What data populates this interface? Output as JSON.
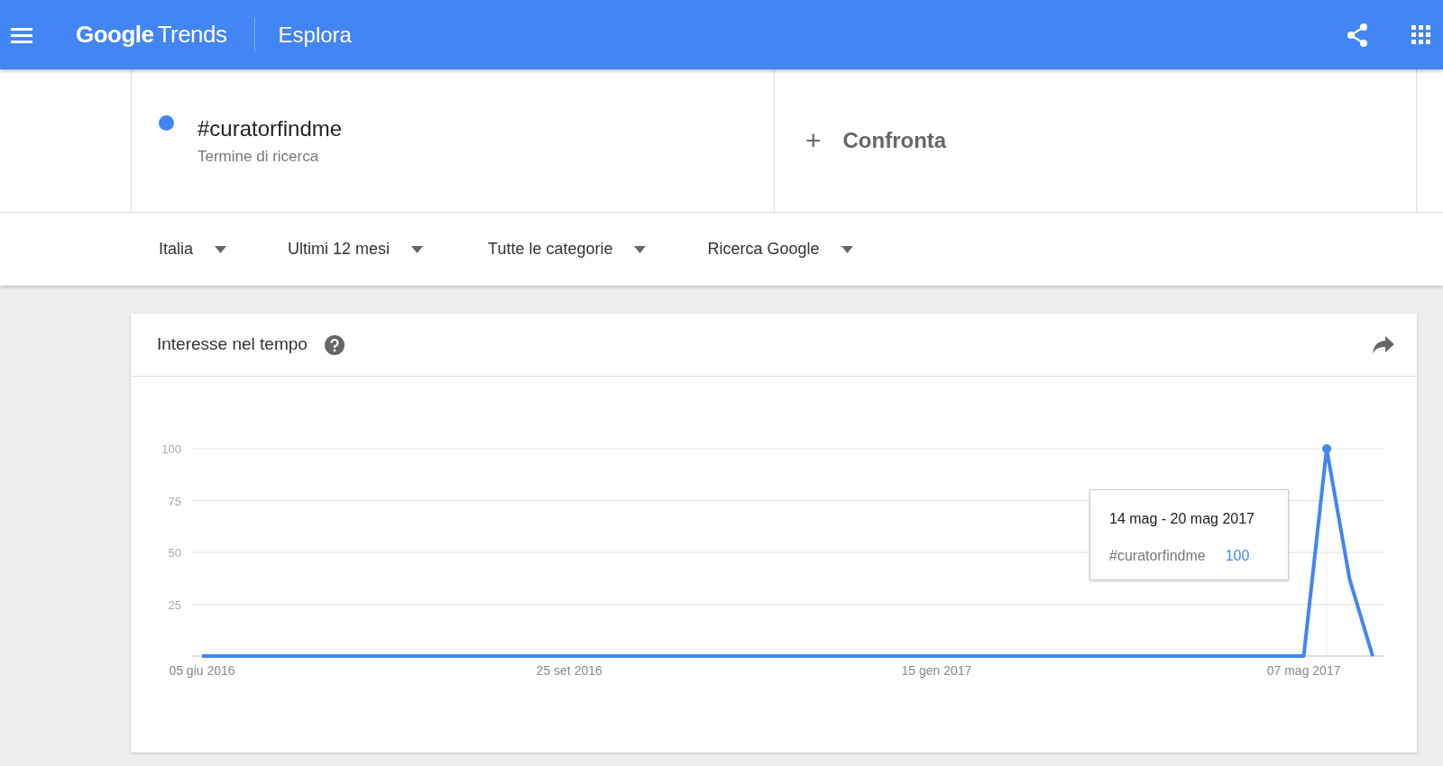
{
  "header": {
    "brand_google": "Google",
    "brand_product": "Trends",
    "page_title": "Esplora"
  },
  "search_terms": [
    {
      "term": "#curatorfindme",
      "subtitle": "Termine di ricerca",
      "color": "#4285f4"
    }
  ],
  "compare": {
    "icon": "+",
    "label": "Confronta"
  },
  "filters": [
    {
      "label": "Italia"
    },
    {
      "label": "Ultimi 12 mesi"
    },
    {
      "label": "Tutte le categorie"
    },
    {
      "label": "Ricerca Google"
    }
  ],
  "interest_card": {
    "title": "Interesse nel tempo",
    "chart_data": {
      "type": "line",
      "categories": [
        "05 giu 2016",
        null,
        null,
        null,
        null,
        null,
        null,
        null,
        null,
        null,
        null,
        null,
        null,
        null,
        null,
        null,
        "25 set 2016",
        null,
        null,
        null,
        null,
        null,
        null,
        null,
        null,
        null,
        null,
        null,
        null,
        null,
        null,
        null,
        "15 gen 2017",
        null,
        null,
        null,
        null,
        null,
        null,
        null,
        null,
        null,
        null,
        null,
        null,
        null,
        null,
        null,
        "07 mag 2017",
        null,
        null,
        null
      ],
      "series": [
        {
          "color": "#4285f4",
          "values": [
            0,
            0,
            0,
            0,
            0,
            0,
            0,
            0,
            0,
            0,
            0,
            0,
            0,
            0,
            0,
            0,
            0,
            0,
            0,
            0,
            0,
            0,
            0,
            0,
            0,
            0,
            0,
            0,
            0,
            0,
            0,
            0,
            0,
            0,
            0,
            0,
            0,
            0,
            0,
            0,
            0,
            0,
            0,
            0,
            0,
            0,
            0,
            0,
            0,
            100,
            37,
            0
          ]
        }
      ],
      "grid": true,
      "ylim": [
        0,
        100
      ],
      "yticks": [
        25,
        50,
        75,
        100
      ]
    },
    "tooltip": {
      "date": "14 mag - 20 mag 2017",
      "term": "#curatorfindme",
      "value": "100"
    }
  }
}
